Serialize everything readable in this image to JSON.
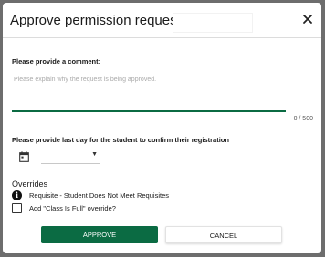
{
  "dialog": {
    "title": "Approve permission request for",
    "close_icon": "close-icon"
  },
  "comment": {
    "label": "Please provide a comment:",
    "placeholder": "Please explain why the request is being approved.",
    "value": "",
    "counter": "0 / 500"
  },
  "last_day": {
    "label": "Please provide last day for the student to confirm their registration",
    "calendar_icon": "calendar-icon",
    "selected_value": "",
    "chevron_icon": "chevron-down-icon"
  },
  "overrides": {
    "title": "Overrides",
    "info_icon": "info-icon",
    "requisite_text": "Requisite - Student Does Not Meet Requisites",
    "class_full_label": "Add \"Class Is Full\" override?",
    "class_full_checked": false
  },
  "actions": {
    "approve_label": "APPROVE",
    "cancel_label": "CANCEL"
  },
  "colors": {
    "accent": "#0b6b43",
    "backdrop": "#6d6d6d"
  }
}
